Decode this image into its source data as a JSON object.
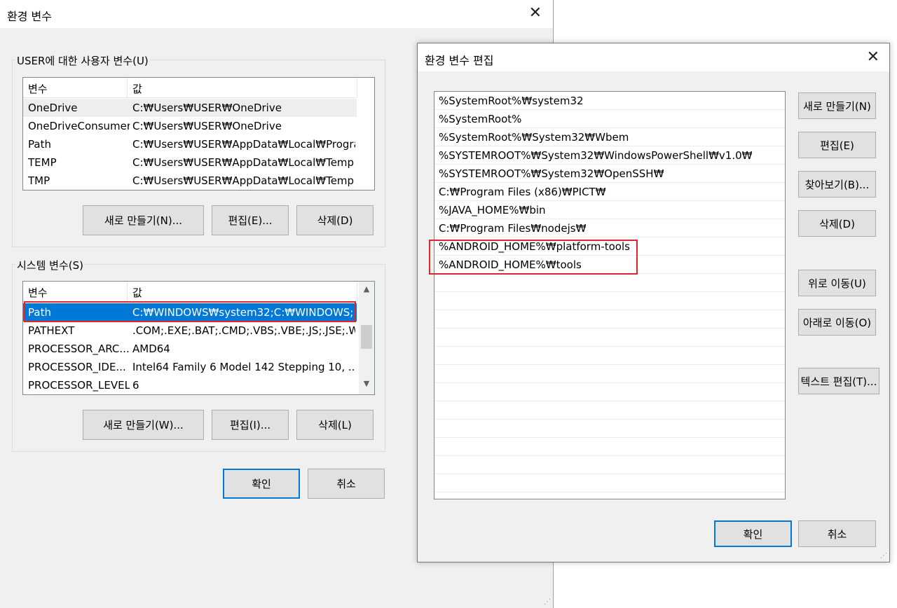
{
  "env_dialog": {
    "title": "환경 변수",
    "user_group_label": "USER에 대한 사용자 변수(U)",
    "user_headers": [
      "변수",
      "값"
    ],
    "user_rows": [
      {
        "name": "OneDrive",
        "value": "C:₩Users₩USER₩OneDrive"
      },
      {
        "name": "OneDriveConsumer",
        "value": "C:₩Users₩USER₩OneDrive"
      },
      {
        "name": "Path",
        "value": "C:₩Users₩USER₩AppData₩Local₩Progra..."
      },
      {
        "name": "TEMP",
        "value": "C:₩Users₩USER₩AppData₩Local₩Temp"
      },
      {
        "name": "TMP",
        "value": "C:₩Users₩USER₩AppData₩Local₩Temp"
      }
    ],
    "user_buttons": {
      "new": "새로 만들기(N)...",
      "edit": "편집(E)...",
      "delete": "삭제(D)"
    },
    "system_group_label": "시스템 변수(S)",
    "system_headers": [
      "변수",
      "값"
    ],
    "system_rows": [
      {
        "name": "Path",
        "value": "C:₩WINDOWS₩system32;C:₩WINDOWS;..."
      },
      {
        "name": "PATHEXT",
        "value": ".COM;.EXE;.BAT;.CMD;.VBS;.VBE;.JS;.JSE;.W..."
      },
      {
        "name": "PROCESSOR_ARC...",
        "value": "AMD64"
      },
      {
        "name": "PROCESSOR_IDE...",
        "value": "Intel64 Family 6 Model 142 Stepping 10, ..."
      },
      {
        "name": "PROCESSOR_LEVEL",
        "value": "6"
      }
    ],
    "system_buttons": {
      "new": "새로 만들기(W)...",
      "edit": "편집(I)...",
      "delete": "삭제(L)"
    },
    "ok": "확인",
    "cancel": "취소"
  },
  "edit_dialog": {
    "title": "환경 변수 편집",
    "paths": [
      "%SystemRoot%₩system32",
      "%SystemRoot%",
      "%SystemRoot%₩System32₩Wbem",
      "%SYSTEMROOT%₩System32₩WindowsPowerShell₩v1.0₩",
      "%SYSTEMROOT%₩System32₩OpenSSH₩",
      "C:₩Program Files (x86)₩PICT₩",
      "%JAVA_HOME%₩bin",
      "C:₩Program Files₩nodejs₩",
      "%ANDROID_HOME%₩platform-tools",
      "%ANDROID_HOME%₩tools"
    ],
    "buttons": {
      "new": "새로 만들기(N)",
      "edit": "편집(E)",
      "browse": "찾아보기(B)...",
      "delete": "삭제(D)",
      "move_up": "위로 이동(U)",
      "move_down": "아래로 이동(O)",
      "edit_text": "텍스트 편집(T)..."
    },
    "ok": "확인",
    "cancel": "취소"
  },
  "colors": {
    "selection": "#0078d7",
    "highlight_box": "#e0262b"
  },
  "icons": {
    "close": "close-icon",
    "scroll_up": "chevron-up-icon",
    "scroll_down": "chevron-down-icon"
  }
}
